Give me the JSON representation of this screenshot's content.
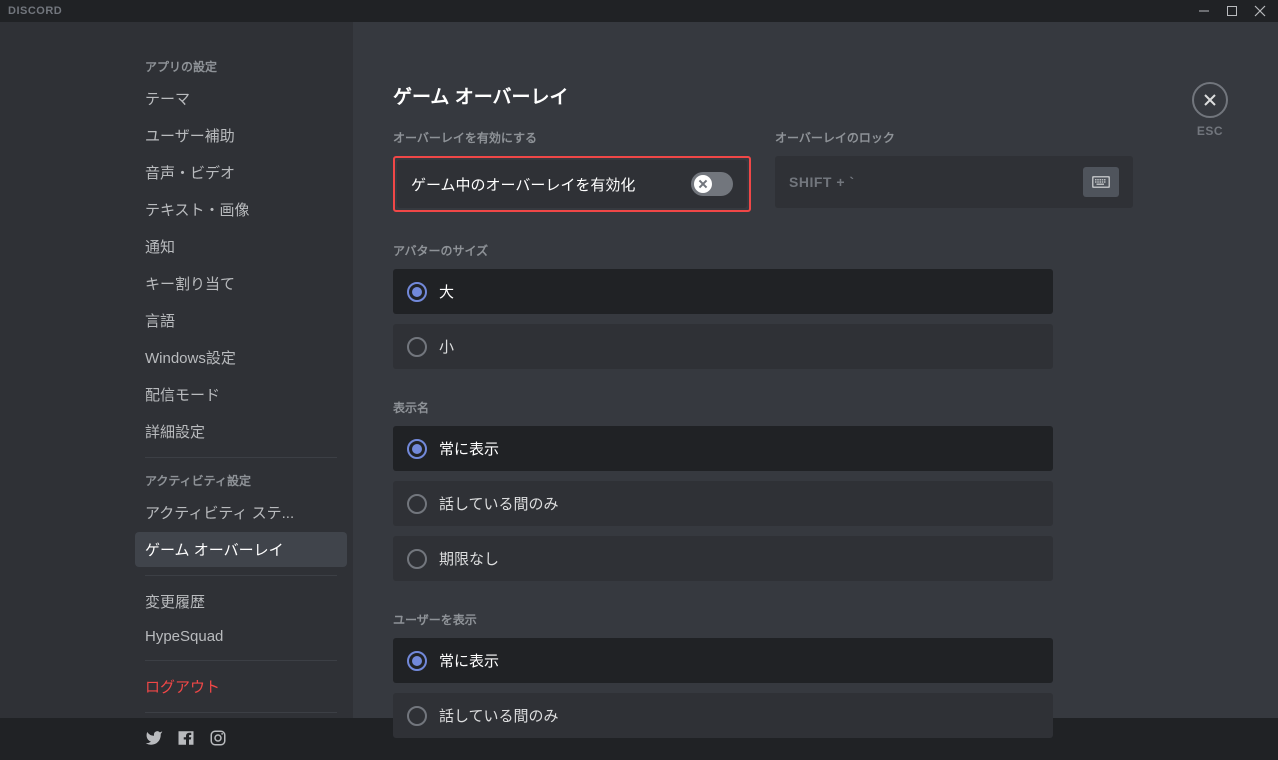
{
  "app_name": "DISCORD",
  "close_label": "ESC",
  "sidebar": {
    "section_app": "アプリの設定",
    "items_app": [
      "テーマ",
      "ユーザー補助",
      "音声・ビデオ",
      "テキスト・画像",
      "通知",
      "キー割り当て",
      "言語",
      "Windows設定",
      "配信モード",
      "詳細設定"
    ],
    "section_activity": "アクティビティ設定",
    "items_activity": [
      "アクティビティ ステ...",
      "ゲーム オーバーレイ"
    ],
    "items_misc": [
      "変更履歴",
      "HypeSquad"
    ],
    "logout": "ログアウト"
  },
  "page": {
    "title": "ゲーム オーバーレイ",
    "enable_section_label": "オーバーレイを有効にする",
    "enable_toggle_label": "ゲーム中のオーバーレイを有効化",
    "lock_section_label": "オーバーレイのロック",
    "lock_keybind": "SHIFT + `",
    "avatar_size_label": "アバターのサイズ",
    "avatar_options": [
      "大",
      "小"
    ],
    "display_name_label": "表示名",
    "display_name_options": [
      "常に表示",
      "話している間のみ",
      "期限なし"
    ],
    "show_user_label": "ユーザーを表示",
    "show_user_options": [
      "常に表示",
      "話している間のみ"
    ]
  }
}
